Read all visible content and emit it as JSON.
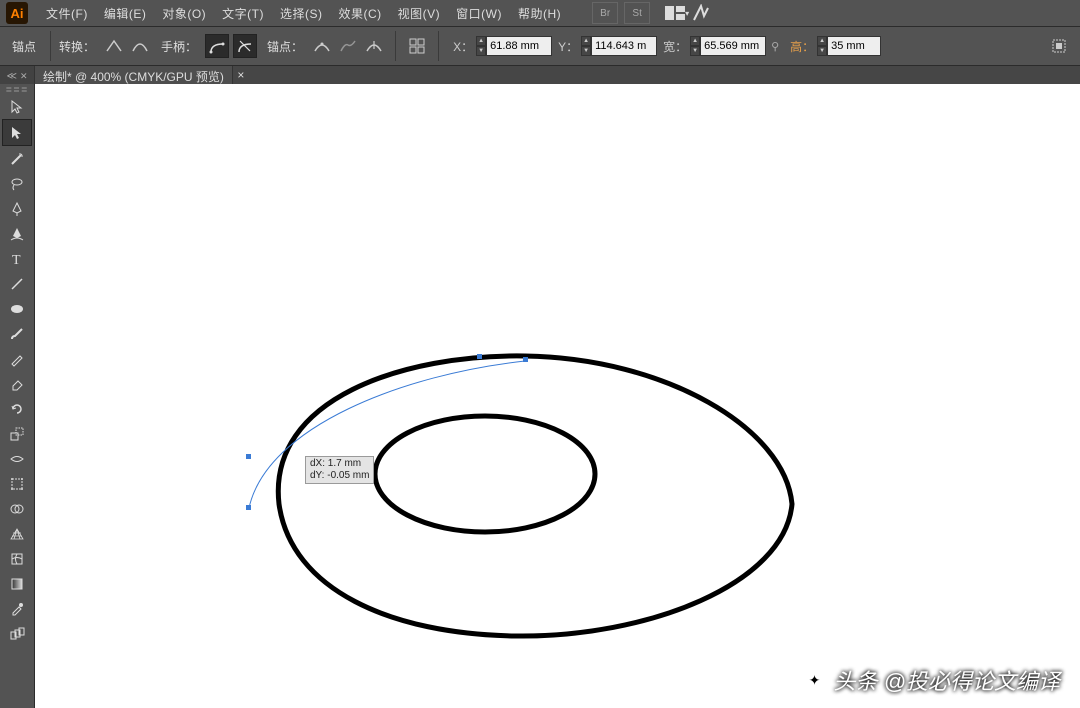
{
  "app_logo": "Ai",
  "menu": {
    "items": [
      "文件(F)",
      "编辑(E)",
      "对象(O)",
      "文字(T)",
      "选择(S)",
      "效果(C)",
      "视图(V)",
      "窗口(W)",
      "帮助(H)"
    ],
    "bridge_icon": "Br",
    "stock_icon": "St"
  },
  "control_bar": {
    "anchor_label": "锚点",
    "convert_label": "转换：",
    "handles_label": "手柄：",
    "anchors_label": "锚点：",
    "x_label": "X：",
    "x_value": "61.88 mm",
    "y_label": "Y：",
    "y_value": "114.643 m",
    "w_label": "宽：",
    "w_value": "65.569 mm",
    "h_label": "高：",
    "h_value": "35 mm"
  },
  "document_tab": {
    "title": "制* @ 400% (CMYK/GPU 预览)",
    "prefix": "绘"
  },
  "measurement": {
    "dx": "dX: 1.7 mm",
    "dy": "dY: -0.05 mm"
  },
  "watermark": {
    "text": "头条 @投必得论文编译"
  },
  "colors": {
    "accent": "#ff8000",
    "panel": "#535353"
  }
}
